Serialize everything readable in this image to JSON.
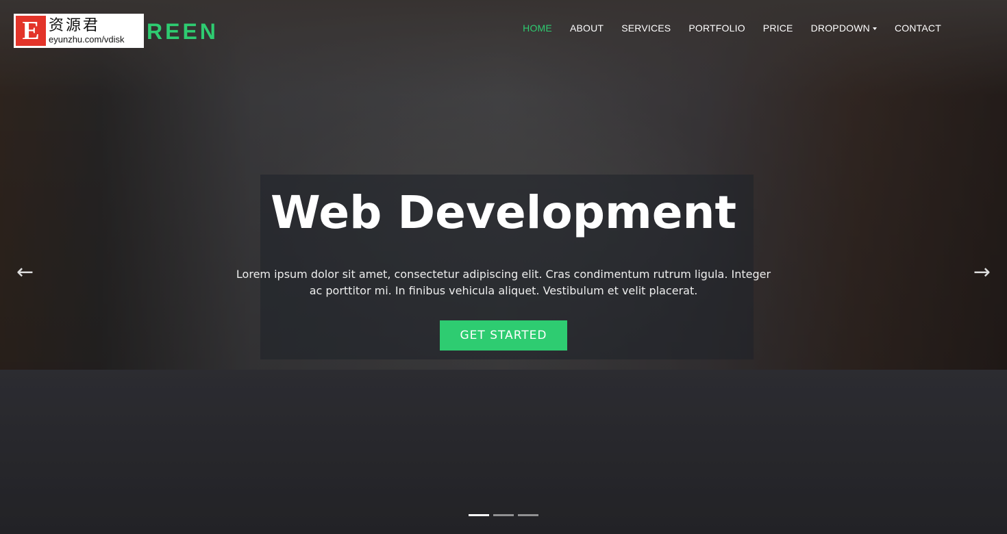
{
  "brand": {
    "logo_text": "REEN",
    "color": "#2ecc71"
  },
  "watermark": {
    "letter": "E",
    "chinese": "资源君",
    "url": "eyunzhu.com/vdisk"
  },
  "nav": {
    "items": [
      {
        "label": "HOME",
        "active": true
      },
      {
        "label": "ABOUT"
      },
      {
        "label": "SERVICES"
      },
      {
        "label": "PORTFOLIO"
      },
      {
        "label": "PRICE"
      },
      {
        "label": "DROPDOWN"
      },
      {
        "label": "CONTACT"
      }
    ]
  },
  "hero": {
    "title": "Web Development",
    "text": "Lorem ipsum dolor sit amet, consectetur adipiscing elit. Cras condimentum rutrum ligula. Integer ac porttitor mi. In finibus vehicula aliquet. Vestibulum et velit placerat.",
    "cta": "GET STARTED"
  },
  "carousel": {
    "prev_icon": "arrow-left-icon",
    "next_icon": "arrow-right-icon",
    "prev": "←",
    "next": "→",
    "slides": 3,
    "active": 1
  }
}
